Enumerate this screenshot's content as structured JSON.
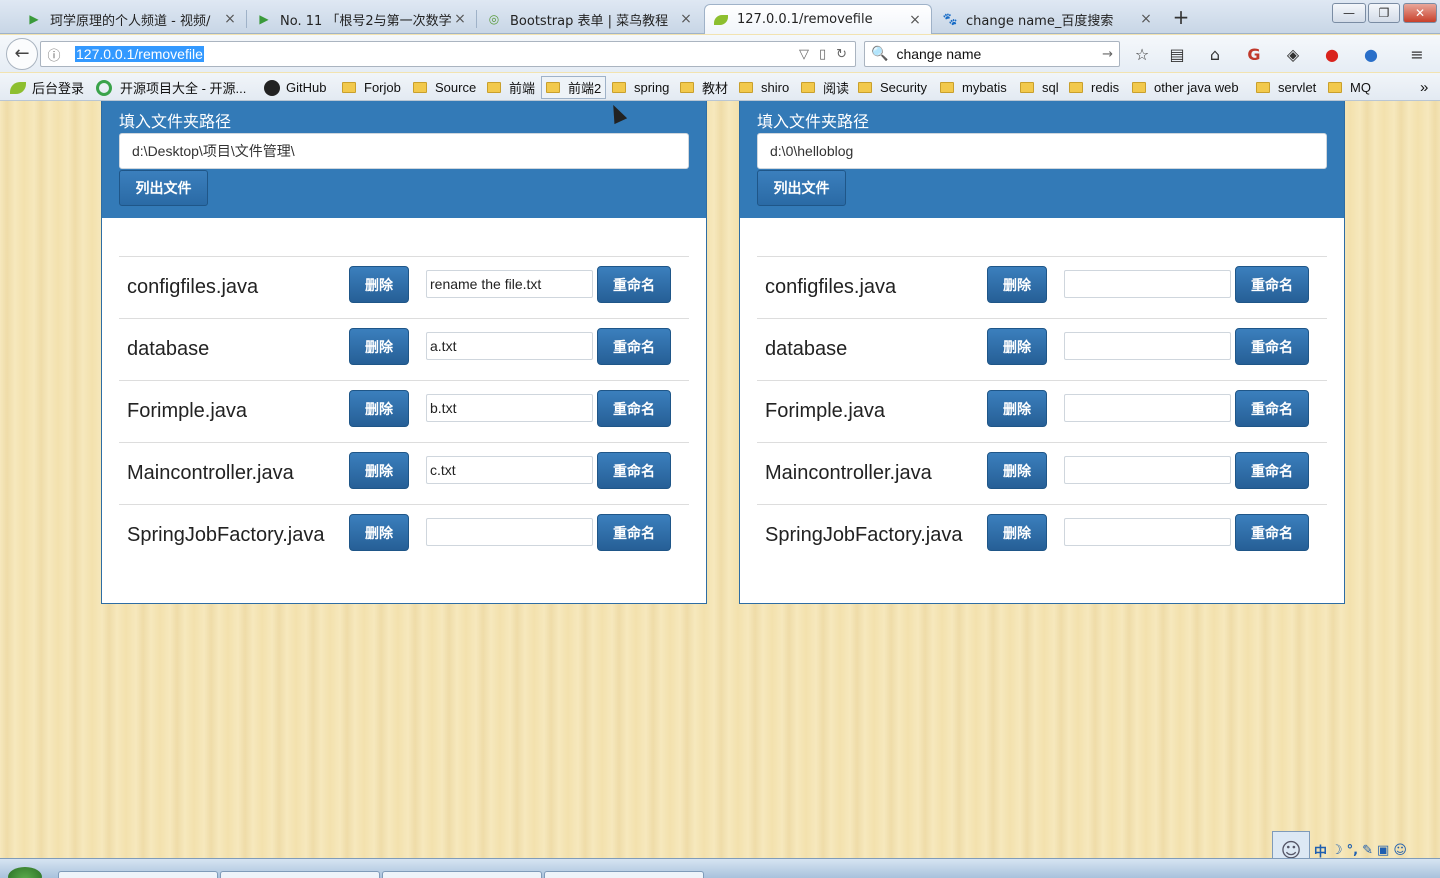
{
  "browser": {
    "tabs": [
      {
        "title": "珂学原理的个人频道 - 视频∕",
        "icon": "play-icon",
        "active": false
      },
      {
        "title": "No. 11 「根号2与第一次数学",
        "icon": "play-icon",
        "active": false
      },
      {
        "title": "Bootstrap 表单 | 菜鸟教程",
        "icon": "runoob-icon",
        "active": false
      },
      {
        "title": "127.0.0.1/removefile",
        "icon": "leaf-icon",
        "active": true
      },
      {
        "title": "change name_百度搜索",
        "icon": "baidu-icon",
        "active": false
      }
    ],
    "url": "127.0.0.1/removefile",
    "search": "change name",
    "bookmarks": [
      "后台登录",
      "开源项目大全 - 开源...",
      "GitHub",
      "Forjob",
      "Source",
      "前端",
      "前端2",
      "spring",
      "教材",
      "shiro",
      "阅读",
      "Security",
      "mybatis",
      "sql",
      "redis",
      "other java web",
      "servlet",
      "MQ"
    ]
  },
  "panels": [
    {
      "label": "填入文件夹路径",
      "path": "d:\\Desktop\\项目\\文件管理\\",
      "list_button": "列出文件",
      "files": [
        {
          "name": "configfiles.java",
          "delete": "删除",
          "new_name": "rename the file.txt",
          "rename": "重命名"
        },
        {
          "name": "database",
          "delete": "删除",
          "new_name": "a.txt",
          "rename": "重命名"
        },
        {
          "name": "Forimple.java",
          "delete": "删除",
          "new_name": "b.txt",
          "rename": "重命名"
        },
        {
          "name": "Maincontroller.java",
          "delete": "删除",
          "new_name": "c.txt",
          "rename": "重命名"
        },
        {
          "name": "SpringJobFactory.java",
          "delete": "删除",
          "new_name": "",
          "rename": "重命名"
        }
      ]
    },
    {
      "label": "填入文件夹路径",
      "path": "d:\\0\\helloblog",
      "list_button": "列出文件",
      "files": [
        {
          "name": "configfiles.java",
          "delete": "删除",
          "new_name": "",
          "rename": "重命名"
        },
        {
          "name": "database",
          "delete": "删除",
          "new_name": "",
          "rename": "重命名"
        },
        {
          "name": "Forimple.java",
          "delete": "删除",
          "new_name": "",
          "rename": "重命名"
        },
        {
          "name": "Maincontroller.java",
          "delete": "删除",
          "new_name": "",
          "rename": "重命名"
        },
        {
          "name": "SpringJobFactory.java",
          "delete": "删除",
          "new_name": "",
          "rename": "重命名"
        }
      ]
    }
  ],
  "taskbar": {
    "ime": "中"
  },
  "colors": {
    "primary": "#337ab7",
    "page_bg": "#f2e3b0"
  }
}
